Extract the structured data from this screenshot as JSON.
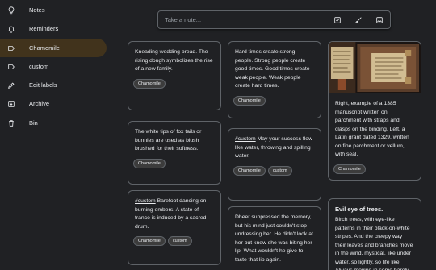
{
  "sidebar": {
    "items": [
      {
        "label": "Notes",
        "icon": "lightbulb-icon",
        "active": false
      },
      {
        "label": "Reminders",
        "icon": "bell-icon",
        "active": false
      },
      {
        "label": "Chamomile",
        "icon": "label-icon",
        "active": true
      },
      {
        "label": "custom",
        "icon": "label-icon",
        "active": false
      },
      {
        "label": "Edit labels",
        "icon": "pencil-icon",
        "active": false
      },
      {
        "label": "Archive",
        "icon": "archive-icon",
        "active": false
      },
      {
        "label": "Bin",
        "icon": "trash-icon",
        "active": false
      }
    ]
  },
  "note_bar": {
    "placeholder": "Take a note..."
  },
  "columns": [
    [
      {
        "text": "Kneading wedding bread. The rising dough symbolizes the rise of a new family.",
        "labels": [
          "Chamomile"
        ]
      },
      {
        "text": "The white tips of fox tails or bunnies are used as blush brushed for their softness.",
        "labels": [
          "Chamomile"
        ]
      },
      {
        "hashtag": "#custom",
        "text": " Barefoot dancing on burning embers. A state of trance is induced by a sacred drum.",
        "labels": [
          "Chamomile",
          "custom"
        ]
      }
    ],
    [
      {
        "text": "Hard times create strong people. Strong people create good times. Good times create weak people. Weak people create hard times.",
        "labels": [
          "Chamomile"
        ]
      },
      {
        "hashtag": "#custom",
        "text": " May your success flow like water, throwing and spilling water.",
        "labels": [
          "Chamomile",
          "custom"
        ]
      },
      {
        "text": "Dheer suppressed the memory, but his mind just couldn't stop undressing her. He didn't look at her but knew she was biting her lip. What wouldn't he give to taste that lip again.",
        "labels": []
      }
    ],
    [
      {
        "image": "manuscript-photo",
        "text": "Right, example of a 1385 manuscript written on parchment with straps and clasps on the binding. Left, a Latin grant dated 1329, written on fine parchment or vellum, with seal.",
        "labels": [
          "Chamomile"
        ]
      },
      {
        "title": "Evil eye of trees.",
        "text": "Birch trees, with eye-like patterns in their black-on-white stripes. And the creepy way their leaves and branches move in the wind, mystical, like under water, so lightly, so life like. Always moving in some barely",
        "labels": []
      }
    ]
  ],
  "colors": {
    "background": "#202124",
    "active_nav": "#41331c",
    "border": "#5f6368"
  }
}
